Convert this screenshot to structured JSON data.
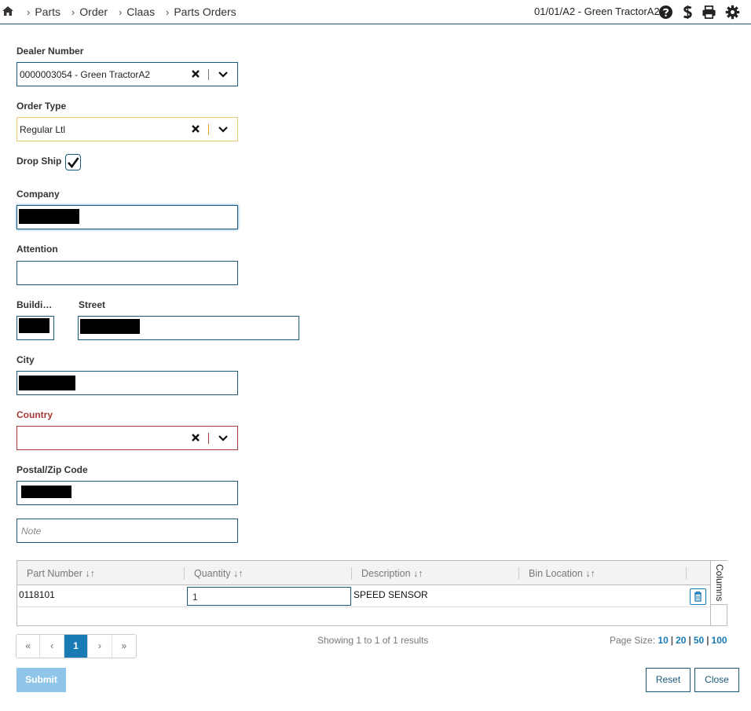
{
  "breadcrumb": [
    "Parts",
    "Order",
    "Claas",
    "Parts Orders"
  ],
  "header": {
    "dealer_context": "01/01/A2 - Green TractorA2"
  },
  "form": {
    "dealer_number": {
      "label": "Dealer Number",
      "value": "0000003054 - Green TractorA2"
    },
    "order_type": {
      "label": "Order Type",
      "value": "Regular Ltl"
    },
    "drop_ship": {
      "label": "Drop Ship",
      "checked": true
    },
    "company": {
      "label": "Company",
      "value": "[redacted]"
    },
    "attention": {
      "label": "Attention",
      "value": ""
    },
    "building": {
      "label": "Buildi…",
      "value": "[redacted]"
    },
    "street": {
      "label": "Street",
      "value": "[redacted]"
    },
    "city": {
      "label": "City",
      "value": "[redacted]"
    },
    "country": {
      "label": "Country",
      "value": "",
      "state": "error"
    },
    "postal": {
      "label": "Postal/Zip Code",
      "value": "[redacted]"
    },
    "note": {
      "placeholder": "Note",
      "value": ""
    }
  },
  "grid": {
    "columns": [
      "Part Number",
      "Quantity",
      "Description",
      "Bin Location"
    ],
    "columns_toggle_label": "Columns",
    "rows": [
      {
        "part_number": "0118101",
        "quantity": "1",
        "description": "SPEED SENSOR",
        "bin_location": ""
      }
    ]
  },
  "pagination": {
    "first": "«",
    "prev": "‹",
    "current": "1",
    "next": "›",
    "last": "»",
    "summary": "Showing 1 to 1 of 1 results",
    "page_size_label": "Page Size:",
    "page_sizes": [
      "10",
      "20",
      "50",
      "100"
    ]
  },
  "actions": {
    "submit": "Submit",
    "reset": "Reset",
    "close": "Close"
  },
  "colors": {
    "primary": "#1a5a7a",
    "accent": "#1a7ab4",
    "error": "#a53a3a",
    "warning": "#e8c97a"
  }
}
